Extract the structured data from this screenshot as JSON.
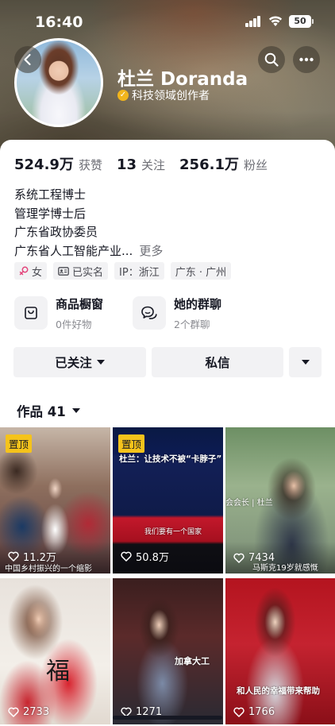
{
  "status_bar": {
    "time": "16:40",
    "battery": "50"
  },
  "profile": {
    "name": "杜兰 Doranda",
    "verification": "科技领域创作者"
  },
  "stats": [
    {
      "value": "524.9万",
      "label": "获赞"
    },
    {
      "value": "13",
      "label": "关注"
    },
    {
      "value": "256.1万",
      "label": "粉丝"
    }
  ],
  "bio": {
    "lines": [
      "系统工程博士",
      "管理学博士后",
      "广东省政协委员",
      "广东省人工智能产业..."
    ],
    "more": "更多"
  },
  "tags": [
    {
      "icon": "female-icon",
      "label": "女"
    },
    {
      "icon": "id-card-icon",
      "label": "已实名"
    },
    {
      "icon": "",
      "label": "IP：浙江"
    },
    {
      "icon": "",
      "label": "广东 · 广州"
    }
  ],
  "features": {
    "shop": {
      "title": "商品橱窗",
      "subtitle": "0件好物"
    },
    "groups": {
      "title": "她的群聊",
      "subtitle": "2个群聊"
    }
  },
  "actions": {
    "follow": "已关注",
    "message": "私信"
  },
  "works": {
    "tab_label": "作品 41",
    "pinned_label": "置顶",
    "items": [
      {
        "pinned": true,
        "likes": "11.2万",
        "caption": "中国乡村振兴的一个缩影"
      },
      {
        "pinned": true,
        "likes": "50.8万",
        "caption": "杜兰：让技术不被“卡脖子”",
        "subcaption": "我们要有一个国家"
      },
      {
        "pinned": false,
        "likes": "7434",
        "caption": "马斯克19岁就感慨",
        "overlay": "会会长 | 杜兰"
      },
      {
        "pinned": false,
        "likes": "2733",
        "caption": ""
      },
      {
        "pinned": false,
        "likes": "1271",
        "caption": "",
        "overlay": "加拿大工"
      },
      {
        "pinned": false,
        "likes": "1766",
        "caption": "和人民的幸福带来帮助"
      }
    ]
  },
  "colors": {
    "pin": "#f5c31b",
    "verify": "#f2b51c",
    "text": "#161823",
    "muted": "#6d6e75"
  }
}
